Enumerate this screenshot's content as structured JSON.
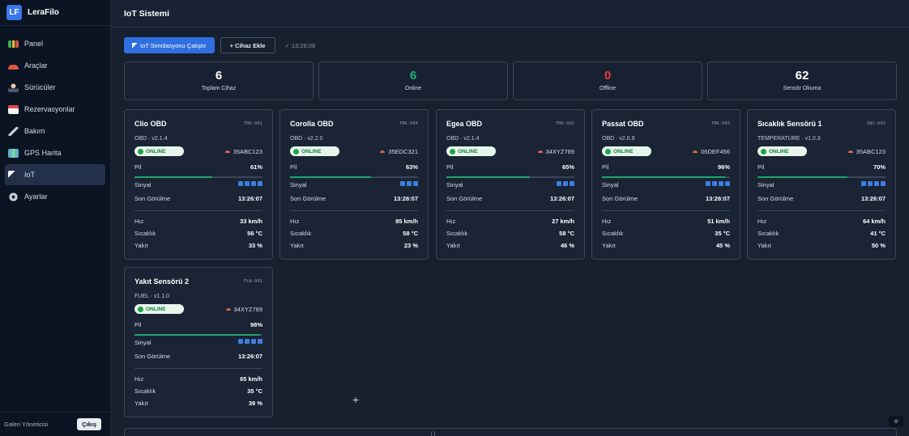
{
  "app": {
    "logo_text": "LF",
    "name": "LeraFilo"
  },
  "sidebar": {
    "items": [
      {
        "label": "Panel",
        "icon": "chart-icon",
        "active": false
      },
      {
        "label": "Araçlar",
        "icon": "car-icon",
        "active": false
      },
      {
        "label": "Sürücüler",
        "icon": "driver-icon",
        "active": false
      },
      {
        "label": "Rezervasyonlar",
        "icon": "calendar-icon",
        "active": false
      },
      {
        "label": "Bakım",
        "icon": "wrench-icon",
        "active": false
      },
      {
        "label": "GPS Harita",
        "icon": "map-icon",
        "active": false
      },
      {
        "label": "IoT",
        "icon": "cursor-icon",
        "active": true
      },
      {
        "label": "Ayarlar",
        "icon": "gear-icon",
        "active": false
      }
    ],
    "user": "Galeri Yöneticisi",
    "logout": "Çıkış"
  },
  "header": {
    "title": "IoT Sistemi"
  },
  "toolbar": {
    "run_label": "IoT Simülasyonu Çalıştır",
    "add_label": "+ Cihaz Ekle",
    "last_update": "✓ 13:26:08"
  },
  "stats": [
    {
      "value": "6",
      "label": "Toplam Cihaz",
      "color": "#ffffff"
    },
    {
      "value": "6",
      "label": "Online",
      "color": "#1fb37a"
    },
    {
      "value": "0",
      "label": "Offline",
      "color": "#e53b3b"
    },
    {
      "value": "62",
      "label": "Sensör Okuma",
      "color": "#ffffff"
    }
  ],
  "labels": {
    "battery": "Pil",
    "signal": "Sinyal",
    "last_seen": "Son Görülme",
    "speed": "Hız",
    "temp": "Sıcaklık",
    "fuel": "Yakıt"
  },
  "devices": [
    {
      "name": "Clio OBD",
      "code": "TRK-001",
      "version": "OBD · v2.1.4",
      "status": "ONLINE",
      "plate": "35ABC123",
      "battery": "61%",
      "battery_level": 0.61,
      "signal_bars": 4,
      "last_seen": "13:26:07",
      "speed": "33 km/h",
      "temp": "56 °C",
      "fuel": "33 %"
    },
    {
      "name": "Corolla OBD",
      "code": "TRK-004",
      "version": "OBD · v2.2.0",
      "status": "ONLINE",
      "plate": "35EDC321",
      "battery": "63%",
      "battery_level": 0.63,
      "signal_bars": 3,
      "last_seen": "13:26:07",
      "speed": "85 km/h",
      "temp": "58 °C",
      "fuel": "23 %"
    },
    {
      "name": "Egea OBD",
      "code": "TRK-002",
      "version": "OBD · v2.1.4",
      "status": "ONLINE",
      "plate": "34XYZ789",
      "battery": "65%",
      "battery_level": 0.65,
      "signal_bars": 3,
      "last_seen": "13:26:07",
      "speed": "27 km/h",
      "temp": "58 °C",
      "fuel": "46 %"
    },
    {
      "name": "Passat OBD",
      "code": "TRK-003",
      "version": "OBD · v2.0.9",
      "status": "ONLINE",
      "plate": "06DEF456",
      "battery": "96%",
      "battery_level": 0.96,
      "signal_bars": 4,
      "last_seen": "13:26:07",
      "speed": "51 km/h",
      "temp": "35 °C",
      "fuel": "45 %"
    },
    {
      "name": "Sıcaklık Sensörü 1",
      "code": "SNS-001",
      "version": "TEMPERATURE · v1.0.3",
      "status": "ONLINE",
      "plate": "35ABC123",
      "battery": "70%",
      "battery_level": 0.7,
      "signal_bars": 4,
      "last_seen": "13:26:07",
      "speed": "64 km/h",
      "temp": "41 °C",
      "fuel": "50 %"
    },
    {
      "name": "Yakıt Sensörü 2",
      "code": "FLW-001",
      "version": "FUEL · v1.1.0",
      "status": "ONLINE",
      "plate": "34XYZ789",
      "battery": "98%",
      "battery_level": 0.98,
      "signal_bars": 4,
      "last_seen": "13:26:07",
      "speed": "65 km/h",
      "temp": "35 °C",
      "fuel": "39 %"
    }
  ],
  "bottom": {
    "mark": "[ ]"
  }
}
